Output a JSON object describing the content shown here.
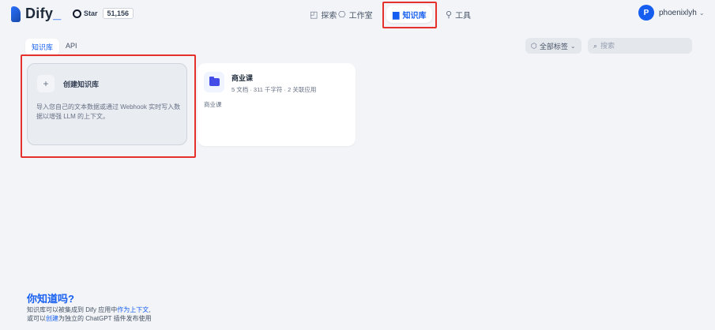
{
  "header": {
    "logo_text": "Dify",
    "logo_cursor": "_",
    "github_star_label": "Star",
    "github_star_count": "51,156",
    "nav": [
      {
        "label": "探索",
        "icon": "explore-icon"
      },
      {
        "label": "工作室",
        "icon": "studio-icon"
      },
      {
        "label": "知识库",
        "icon": "book-icon",
        "active": true
      },
      {
        "label": "工具",
        "icon": "tools-icon"
      }
    ],
    "user_initial": "P",
    "user_name": "phoenixlyh"
  },
  "tabs": [
    {
      "label": "知识库",
      "active": true
    },
    {
      "label": "API",
      "active": false
    }
  ],
  "filter": {
    "tag_label": "全部标签",
    "search_placeholder": "搜索"
  },
  "create_card": {
    "plus": "+",
    "title": "创建知识库",
    "description": "导入您自己的文本数据或通过 Webhook 实时写入数据以增强 LLM 的上下文。"
  },
  "datasets": [
    {
      "name": "商业课",
      "meta": "5 文档 · 311 千字符 · 2 关联应用",
      "description": "商业课"
    }
  ],
  "tip": {
    "title": "你知道吗?",
    "line1_prefix": "知识库可以被集成到 Dify 应用中",
    "line1_link": "作为上下文",
    "line2_prefix": "或可以",
    "line2_link": "创建",
    "line2_suffix": "为独立的 ChatGPT 插件发布使用"
  },
  "colors": {
    "accent": "#155eef",
    "annotation_red": "#e5302b",
    "background": "#f2f4f7"
  }
}
